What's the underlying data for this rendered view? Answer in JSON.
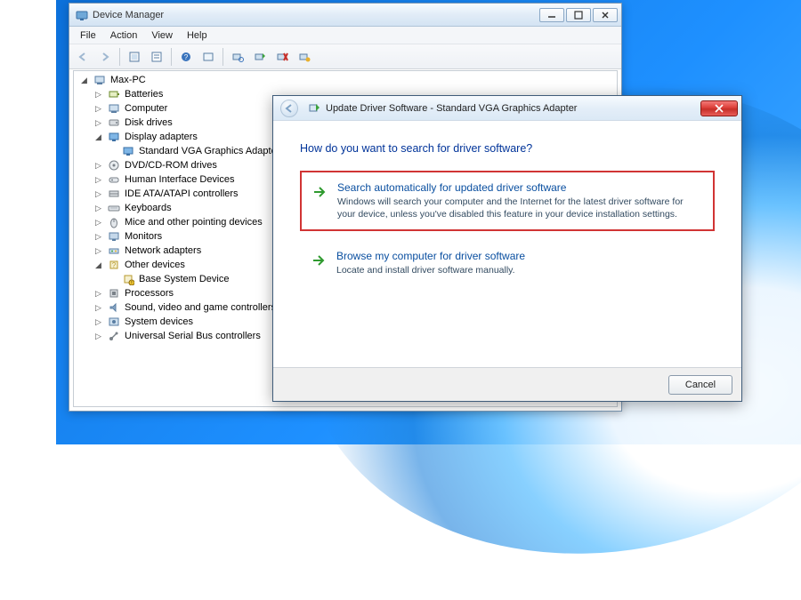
{
  "device_manager": {
    "title": "Device Manager",
    "menus": [
      "File",
      "Action",
      "View",
      "Help"
    ],
    "root": "Max-PC",
    "categories": [
      {
        "label": "Batteries",
        "icon": "battery",
        "expanded": false,
        "children": []
      },
      {
        "label": "Computer",
        "icon": "computer",
        "expanded": false,
        "children": []
      },
      {
        "label": "Disk drives",
        "icon": "disk",
        "expanded": false,
        "children": []
      },
      {
        "label": "Display adapters",
        "icon": "display",
        "expanded": true,
        "children": [
          {
            "label": "Standard VGA Graphics Adapter",
            "icon": "display"
          }
        ]
      },
      {
        "label": "DVD/CD-ROM drives",
        "icon": "dvd",
        "expanded": false,
        "children": []
      },
      {
        "label": "Human Interface Devices",
        "icon": "hid",
        "expanded": false,
        "children": []
      },
      {
        "label": "IDE ATA/ATAPI controllers",
        "icon": "ide",
        "expanded": false,
        "children": []
      },
      {
        "label": "Keyboards",
        "icon": "keyboard",
        "expanded": false,
        "children": []
      },
      {
        "label": "Mice and other pointing devices",
        "icon": "mouse",
        "expanded": false,
        "children": []
      },
      {
        "label": "Monitors",
        "icon": "monitor",
        "expanded": false,
        "children": []
      },
      {
        "label": "Network adapters",
        "icon": "network",
        "expanded": false,
        "children": []
      },
      {
        "label": "Other devices",
        "icon": "other",
        "expanded": true,
        "children": [
          {
            "label": "Base System Device",
            "icon": "other-warn"
          }
        ]
      },
      {
        "label": "Processors",
        "icon": "cpu",
        "expanded": false,
        "children": []
      },
      {
        "label": "Sound, video and game controllers",
        "icon": "sound",
        "expanded": false,
        "children": []
      },
      {
        "label": "System devices",
        "icon": "system",
        "expanded": false,
        "children": []
      },
      {
        "label": "Universal Serial Bus controllers",
        "icon": "usb",
        "expanded": false,
        "children": []
      }
    ]
  },
  "update_dialog": {
    "title": "Update Driver Software - Standard VGA Graphics Adapter",
    "heading": "How do you want to search for driver software?",
    "option1": {
      "title": "Search automatically for updated driver software",
      "desc": "Windows will search your computer and the Internet for the latest driver software for your device, unless you've disabled this feature in your device installation settings."
    },
    "option2": {
      "title": "Browse my computer for driver software",
      "desc": "Locate and install driver software manually."
    },
    "cancel": "Cancel"
  }
}
